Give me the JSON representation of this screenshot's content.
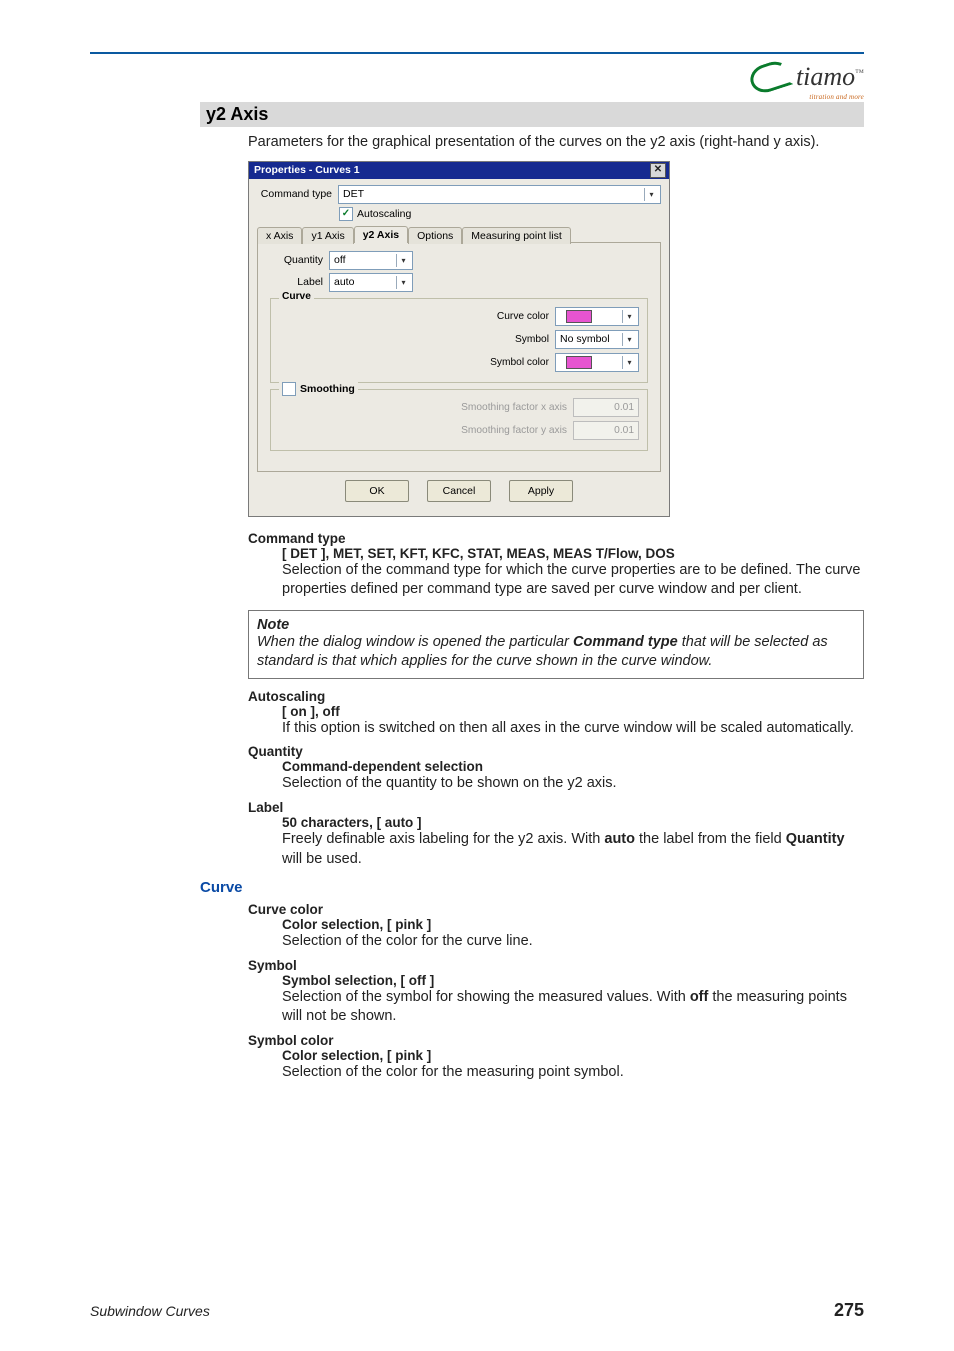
{
  "brand": {
    "name": "tiamo",
    "tm": "™",
    "tagline": "titration and more"
  },
  "section": {
    "title": "y2 Axis",
    "intro": "Parameters for the graphical presentation of the curves on the y2 axis (right-hand y axis)."
  },
  "dialog": {
    "title": "Properties - Curves 1",
    "close_glyph": "✕",
    "command_type_label": "Command type",
    "command_type_value": "DET",
    "autoscaling_label": "Autoscaling",
    "autoscaling_checked": true,
    "tabs": [
      "x Axis",
      "y1 Axis",
      "y2 Axis",
      "Options",
      "Measuring point list"
    ],
    "active_tab": "y2 Axis",
    "y2": {
      "quantity_label": "Quantity",
      "quantity_value": "off",
      "label_label": "Label",
      "label_value": "auto",
      "curve_legend": "Curve",
      "curve_color_label": "Curve color",
      "symbol_label": "Symbol",
      "symbol_value": "No symbol",
      "symbol_color_label": "Symbol color",
      "smoothing_legend": "Smoothing",
      "smoothing_checked": false,
      "sfx_label": "Smoothing factor x axis",
      "sfx_value": "0.01",
      "sfy_label": "Smoothing factor y axis",
      "sfy_value": "0.01"
    },
    "buttons": {
      "ok": "OK",
      "cancel": "Cancel",
      "apply": "Apply"
    }
  },
  "defs": {
    "command_type": {
      "term": "Command type",
      "options": "[ DET ], MET, SET, KFT, KFC, STAT, MEAS, MEAS T/Flow, DOS",
      "text": "Selection of the command type for which the curve properties are to be defined. The curve properties defined per command type are saved per curve window and per client."
    },
    "note": {
      "title": "Note",
      "pre": "When the dialog window is opened the particular ",
      "bold": "Command type",
      "post": " that will be selected as standard is that which applies for the curve shown in the curve window."
    },
    "autoscaling": {
      "term": "Autoscaling",
      "options": "[ on ], off",
      "text": "If this option is switched on then all axes in the curve window will be scaled automatically."
    },
    "quantity": {
      "term": "Quantity",
      "options": "Command-dependent selection",
      "text": "Selection of the quantity to be shown on the y2 axis."
    },
    "label": {
      "term": "Label",
      "options": "50 characters, [ auto ]",
      "text_pre": "Freely definable axis labeling for the y2 axis. With ",
      "bold1": "auto",
      "text_mid": " the label from the field ",
      "bold2": "Quantity",
      "text_post": " will be used."
    }
  },
  "curve_section": {
    "heading": "Curve",
    "curve_color": {
      "term": "Curve color",
      "options": "Color selection, [ pink ]",
      "text": "Selection of the color for the curve line."
    },
    "symbol": {
      "term": "Symbol",
      "options": "Symbol selection, [ off  ]",
      "text_pre": "Selection of the symbol for showing the measured values. With ",
      "bold": "off",
      "text_post": " the measuring points will not be shown."
    },
    "symbol_color": {
      "term": "Symbol color",
      "options": "Color selection, [ pink ]",
      "text": "Selection of the color for the measuring point symbol."
    }
  },
  "footer": {
    "left": "Subwindow Curves",
    "page": "275"
  }
}
